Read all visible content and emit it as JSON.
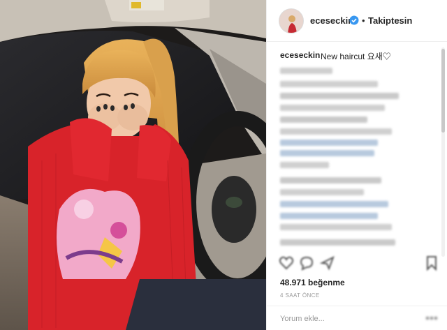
{
  "post": {
    "username": "eceseckin",
    "separator": "•",
    "follow_status": "Takiptesin",
    "caption_user": "eceseckin",
    "caption_text": "New haircut 요새♡",
    "likes": "48.971 beğenme",
    "time": "4 SAAT ÖNCE",
    "comment_placeholder": "Yorum ekle..."
  },
  "colors": {
    "verified": "#3897f0",
    "link_blur": "#b7c9de",
    "text_blur": "#c9c9c9"
  },
  "icons": [
    "verified-badge-icon",
    "heart-icon",
    "comment-icon",
    "share-icon",
    "bookmark-icon",
    "more-options-icon"
  ]
}
